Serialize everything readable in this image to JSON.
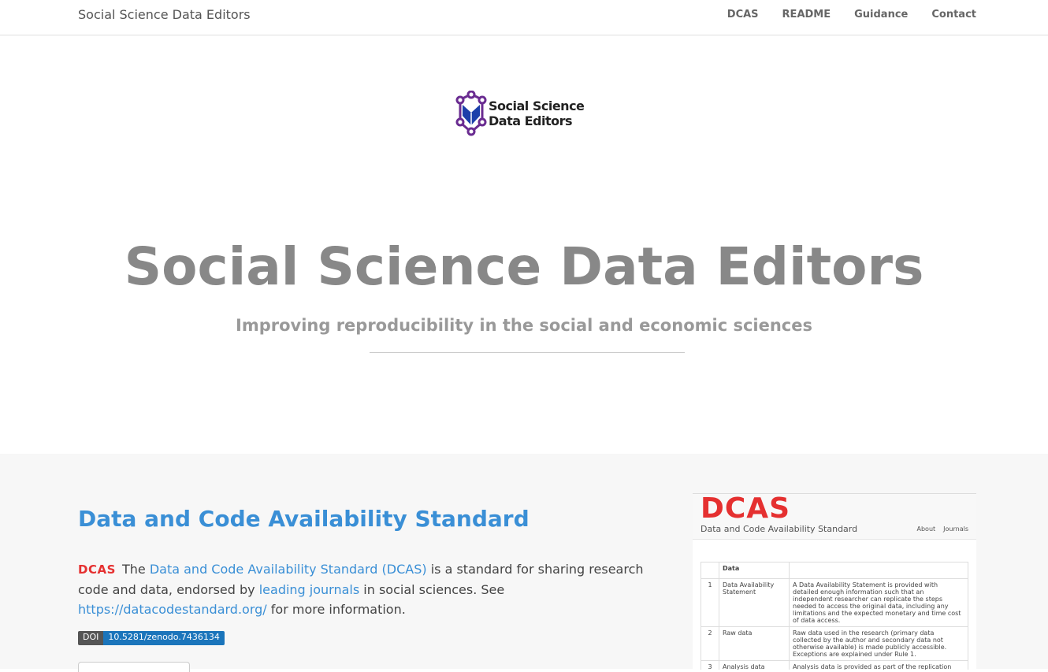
{
  "nav": {
    "brand": "Social Science Data Editors",
    "links": [
      "DCAS",
      "README",
      "Guidance",
      "Contact"
    ]
  },
  "hero": {
    "logo_line1": "Social Science",
    "logo_line2": "Data Editors",
    "title": "Social Science Data Editors",
    "subtitle": "Improving reproducibility in the social and economic sciences"
  },
  "dcas": {
    "title": "Data and Code Availability Standard",
    "icon_text": "DCAS",
    "text_the": "The",
    "link_dcas": "Data and Code Availability Standard (DCAS)",
    "text_1": "is a standard for sharing research code and data, endorsed by",
    "link_journals": "leading journals",
    "text_2": "in social sciences. See",
    "link_url": "https://datacodestandard.org/",
    "text_3": "for more information.",
    "doi_label": "DOI",
    "doi_value": "10.5281/zenodo.7436134"
  },
  "preview": {
    "logo": "DCAS",
    "subtitle": "Data and Code Availability Standard",
    "nav": [
      "About",
      "Journals"
    ],
    "table_header": "Data",
    "rows": [
      {
        "num": "1",
        "name": "Data Availability Statement",
        "desc": "A Data Availability Statement is provided with detailed enough information such that an independent researcher can replicate the steps needed to access the original data, including any limitations and the expected monetary and time cost of data access."
      },
      {
        "num": "2",
        "name": "Raw data",
        "desc": "Raw data used in the research (primary data collected by the author and secondary data not otherwise available) is made publicly accessible. Exceptions are explained under Rule 1."
      },
      {
        "num": "3",
        "name": "Analysis data",
        "desc": "Analysis data is provided as part of the replication package unless they"
      }
    ]
  },
  "colors": {
    "link": "#3a8fd6",
    "dcas_red": "#e53030",
    "hero_title": "#888888",
    "logo_purple": "#6a2c91",
    "logo_blue": "#1c3faa"
  }
}
